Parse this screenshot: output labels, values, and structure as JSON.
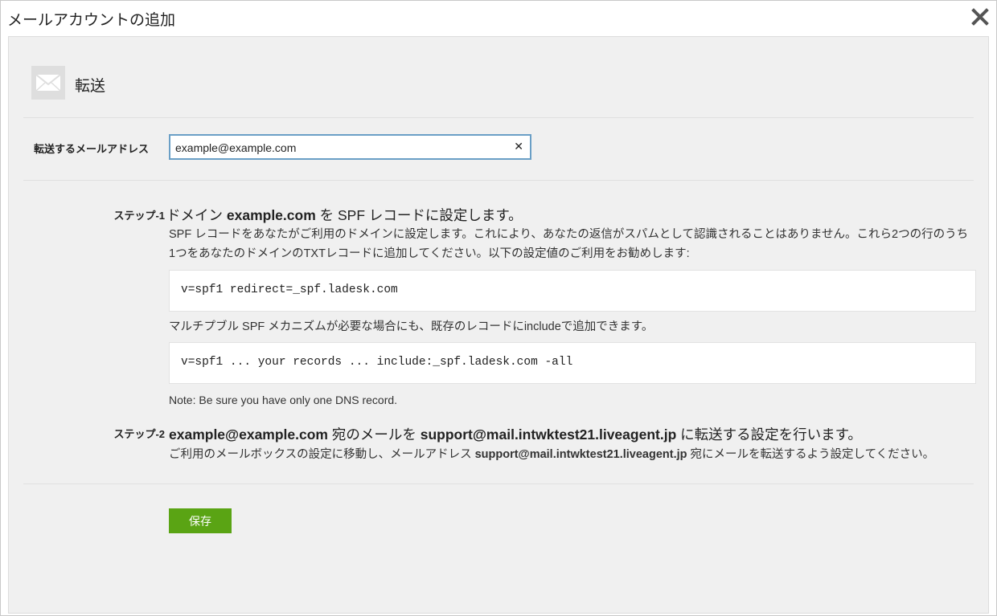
{
  "window": {
    "title": "メールアカウントの追加"
  },
  "header": {
    "title": "転送"
  },
  "form": {
    "label": "転送するメールアドレス",
    "value": "example@example.com"
  },
  "step1": {
    "label": "ステップ-1",
    "head_pre": "ドメイン ",
    "head_domain": "example.com",
    "head_mid": " を ",
    "head_spf": "SPF",
    "head_post": " レコードに設定します。",
    "para_line1": "SPF レコードをあなたがご利用のドメインに設定します。これにより、あなたの返信がスパムとして認識されることはありません。これら2つの行のうち",
    "para_line2": "1つをあなたのドメインのTXTレコードに追加してください。以下の設定値のご利用をお勧めします:",
    "code1": "v=spf1 redirect=_spf.ladesk.com",
    "multi_text": "マルチプブル SPF メカニズムが必要な場合にも、既存のレコードにincludeで追加できます。",
    "code2": "v=spf1 ... your records ... include:_spf.ladesk.com -all",
    "note": "Note: Be sure you have only one DNS record."
  },
  "step2": {
    "label": "ステップ-2",
    "head_email": "example@example.com",
    "head_mid": " 宛のメールを ",
    "head_support": "support@mail.intwktest21.liveagent.jp",
    "head_post": " に転送する設定を行います。",
    "para_pre": "ご利用のメールボックスの設定に移動し、メールアドレス ",
    "para_support": "support@mail.intwktest21.liveagent.jp",
    "para_post": " 宛にメールを転送するよう設定してください。"
  },
  "actions": {
    "save_label": "保存"
  },
  "icons": {
    "close": "close-icon",
    "mail": "mail-icon",
    "clear": "clear-icon"
  },
  "colors": {
    "save_button": "#5aa414",
    "input_border": "#6a9fc6",
    "panel_bg": "#f0f0f0"
  }
}
